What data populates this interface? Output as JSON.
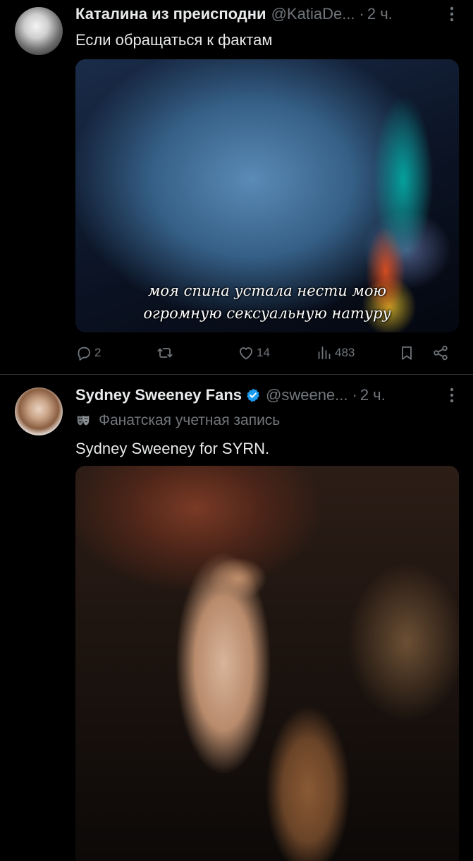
{
  "tweets": [
    {
      "author_name": "Каталина из преисподни",
      "handle": "@KatiaDe...",
      "dot": "·",
      "time": "2 ч.",
      "text": "Если обращаться к фактам",
      "media_caption_line1": "моя спина устала нести мою",
      "media_caption_line2": "огромную сексуальную натуру",
      "replies": "2",
      "retweets": "",
      "likes": "14",
      "views": "483"
    },
    {
      "author_name": "Sydney Sweeney Fans",
      "handle": "@sweene...",
      "dot": "·",
      "time": "2 ч.",
      "verified": true,
      "fan_label": "Фанатская учетная запись",
      "text": "Sydney Sweeney for SYRN."
    }
  ],
  "colors": {
    "background": "#000000",
    "text_primary": "#e7e9ea",
    "text_secondary": "#71767b",
    "verified_badge": "#1d9bf0",
    "divider": "#2f3336"
  },
  "icons": {
    "reply": "reply-icon",
    "retweet": "retweet-icon",
    "like": "heart-icon",
    "views": "views-bar-chart-icon",
    "bookmark": "bookmark-icon",
    "share": "share-icon",
    "more": "more-vertical-icon",
    "verified": "verified-badge-icon",
    "fan_account": "theater-mask-icon"
  }
}
